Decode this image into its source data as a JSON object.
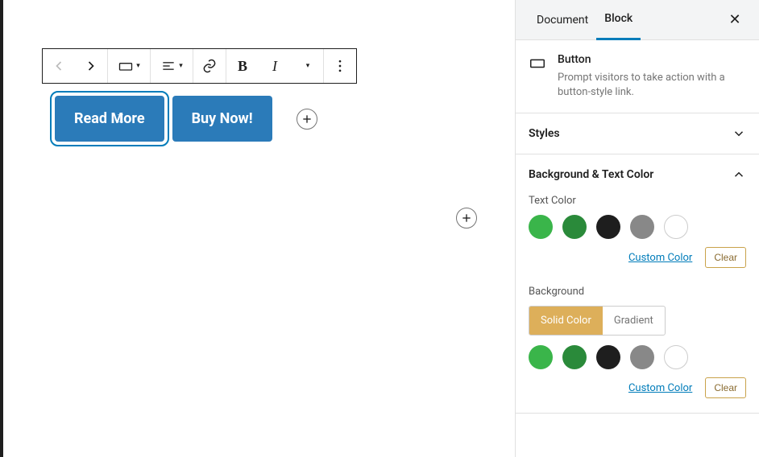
{
  "sidebar": {
    "tabs": {
      "document": "Document",
      "block": "Block"
    },
    "block_name": "Button",
    "block_desc": "Prompt visitors to take action with a button-style link.",
    "panels": {
      "styles": "Styles",
      "bgcolor": "Background & Text Color"
    },
    "text_color_label": "Text Color",
    "background_label": "Background",
    "solid": "Solid Color",
    "gradient": "Gradient",
    "custom_color": "Custom Color",
    "clear": "Clear",
    "swatches": {
      "green1": "#3ab54a",
      "green2": "#2a8a3a",
      "black": "#1e1e1e",
      "gray": "#888888",
      "white": "#ffffff"
    }
  },
  "canvas": {
    "btn1": "Read More",
    "btn2": "Buy Now!"
  }
}
